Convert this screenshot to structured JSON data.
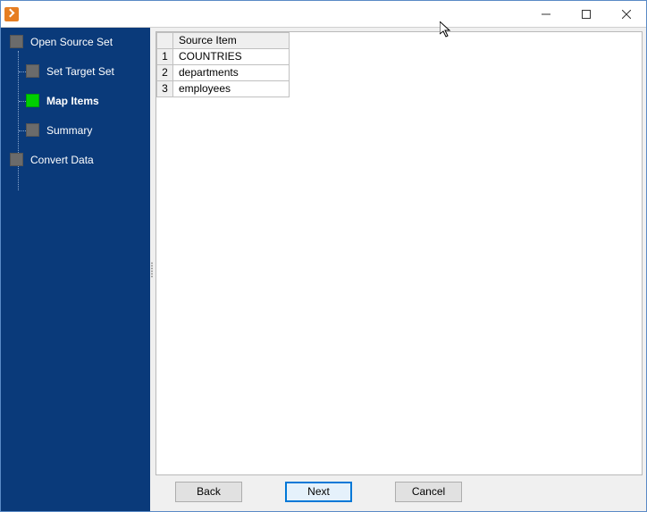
{
  "window": {
    "title": ""
  },
  "sidebar": {
    "steps": [
      {
        "label": "Open Source Set",
        "active": false,
        "child": false
      },
      {
        "label": "Set Target Set",
        "active": false,
        "child": true
      },
      {
        "label": "Map Items",
        "active": true,
        "child": true
      },
      {
        "label": "Summary",
        "active": false,
        "child": true
      },
      {
        "label": "Convert Data",
        "active": false,
        "child": false
      }
    ]
  },
  "table": {
    "header": "Source Item",
    "rows": [
      {
        "n": "1",
        "v": "COUNTRIES"
      },
      {
        "n": "2",
        "v": "departments"
      },
      {
        "n": "3",
        "v": "employees"
      }
    ]
  },
  "footer": {
    "back": "Back",
    "next": "Next",
    "cancel": "Cancel"
  }
}
